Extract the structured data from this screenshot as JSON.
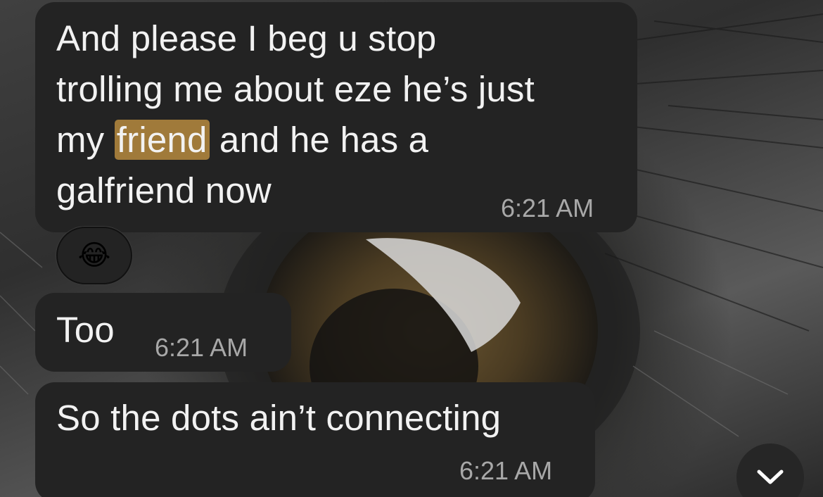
{
  "messages": [
    {
      "lines": [
        "And please I beg u stop",
        "trolling me about eze he’s just"
      ],
      "line3_before": "my ",
      "line3_highlight": "friend",
      "line3_after": " and he has a",
      "line4": "galfriend now",
      "time": "6:21 AM"
    },
    {
      "text": "Too",
      "time": "6:21 AM"
    },
    {
      "text": "So the dots ain’t connecting",
      "time": "6:21 AM"
    }
  ],
  "reaction": {
    "emoji": "😂",
    "icon": "face-with-tears-of-joy"
  },
  "scroll_button": {
    "icon": "chevron-down-icon"
  },
  "colors": {
    "bubble": "#232323",
    "highlight": "#a07a3a",
    "time": "#a8a8a8",
    "text": "#f2f2f2"
  }
}
